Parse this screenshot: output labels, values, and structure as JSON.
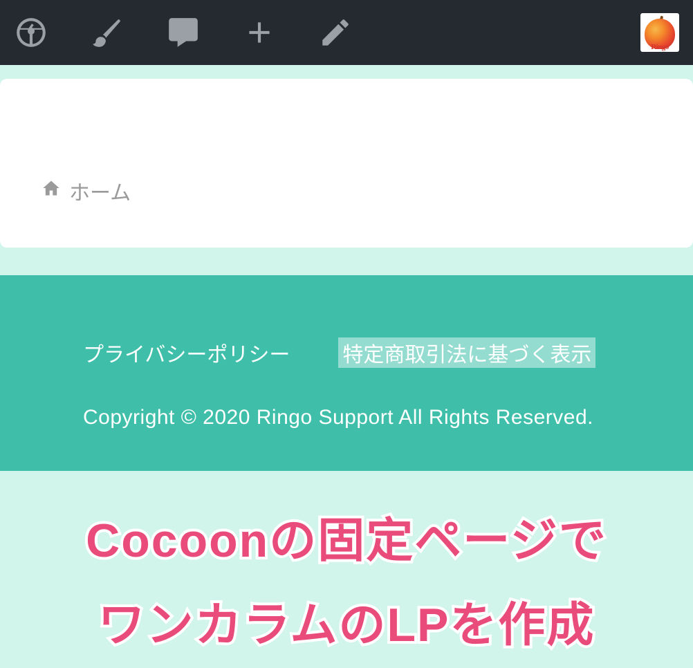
{
  "adminbar": {
    "icons": [
      "dashboard-icon",
      "brush-icon",
      "comment-icon",
      "plus-icon",
      "edit-icon"
    ],
    "avatar_label": "Ringo"
  },
  "breadcrumb": {
    "home_label": "ホーム"
  },
  "footer": {
    "links": [
      {
        "label": "プライバシーポリシー",
        "hovered": false
      },
      {
        "label": "特定商取引法に基づく表示",
        "hovered": true
      }
    ],
    "copyright": "Copyright © 2020 Ringo Support All Rights Reserved."
  },
  "overlay": {
    "line1": "Cocoonの固定ページで",
    "line2": "ワンカラムのLPを作成"
  },
  "colors": {
    "page_bg": "#d1f4eb",
    "footer_bg": "#3fbfa9",
    "overlay_pink": "#e94b7a",
    "adminbar_bg": "#242a30"
  }
}
